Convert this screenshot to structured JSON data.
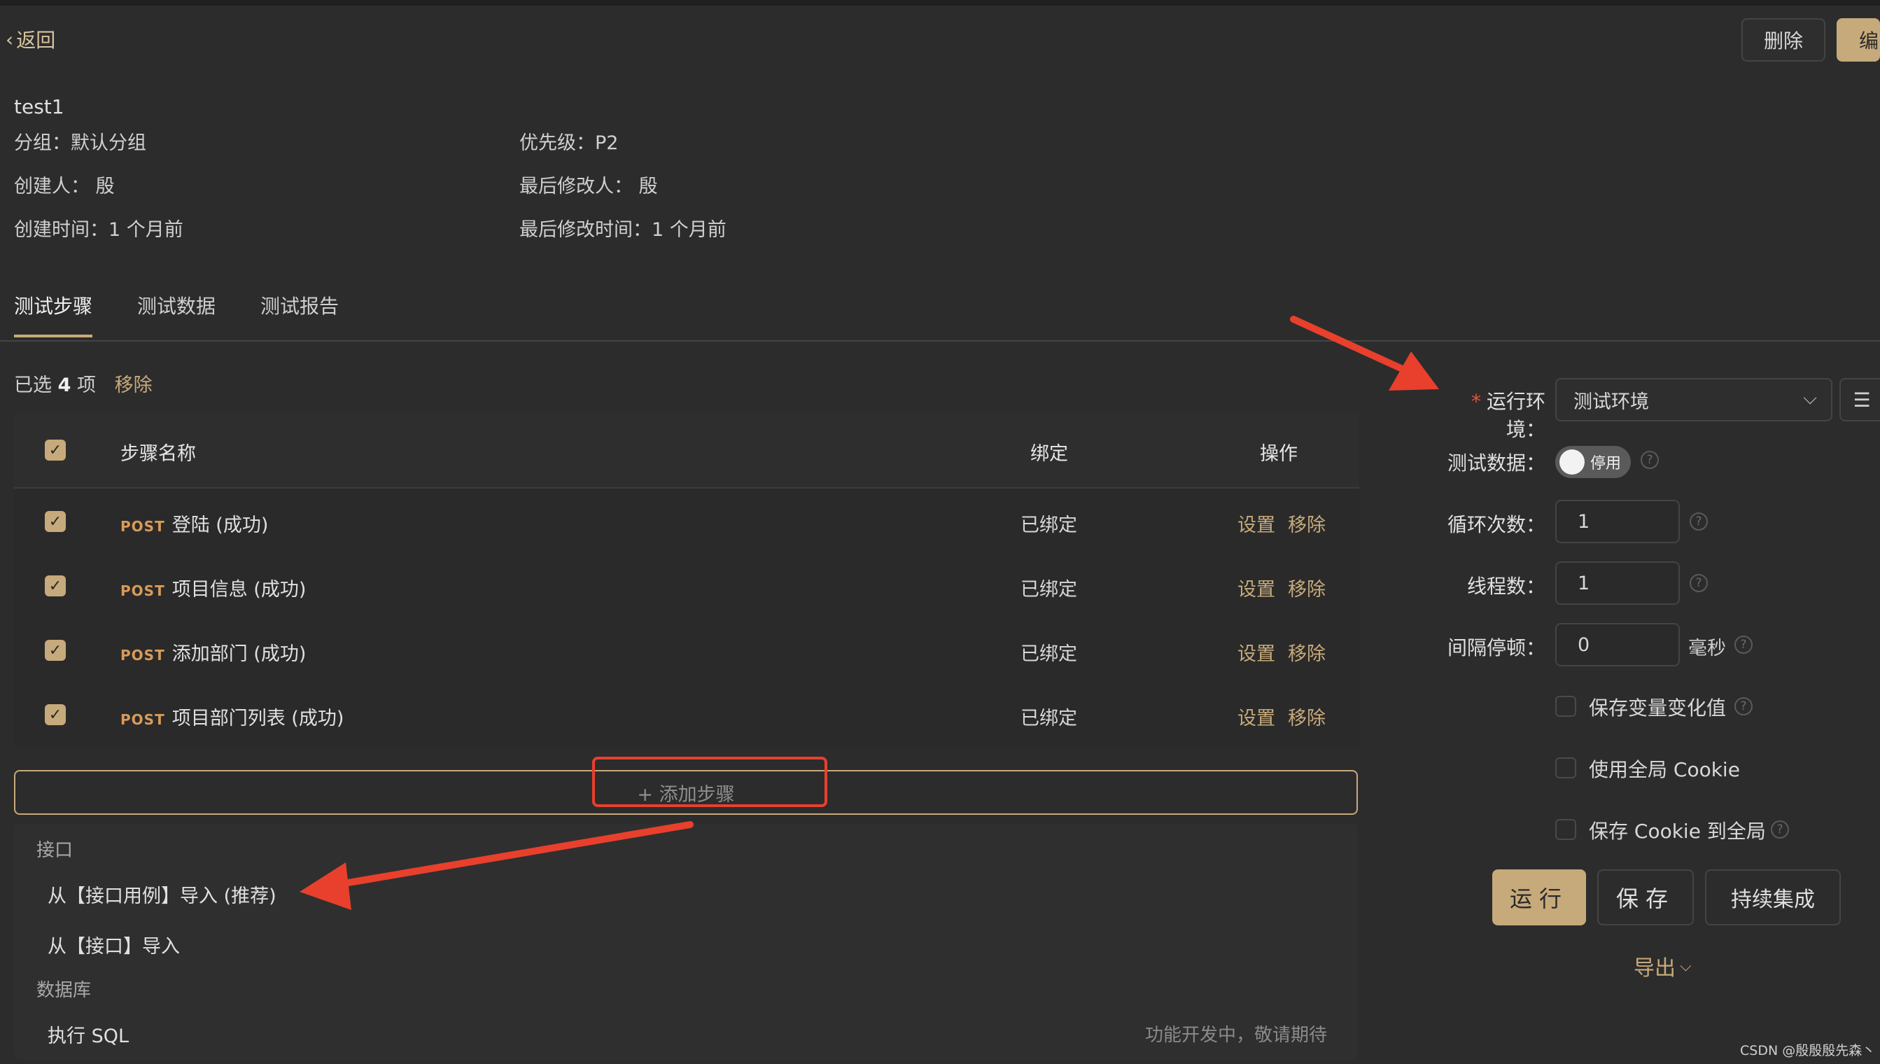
{
  "header": {
    "back_label": "返回",
    "delete_label": "删除",
    "edit_label": "编"
  },
  "meta": {
    "title": "test1",
    "group": "分组：默认分组",
    "priority": "优先级：P2",
    "creator": "创建人： 殷",
    "last_modifier": "最后修改人： 殷",
    "created_time": "创建时间：1 个月前",
    "modified_time": "最后修改时间：1 个月前"
  },
  "tabs": [
    {
      "label": "测试步骤",
      "active": true
    },
    {
      "label": "测试数据",
      "active": false
    },
    {
      "label": "测试报告",
      "active": false
    }
  ],
  "selection": {
    "prefix": "已选",
    "count": "4",
    "suffix": "项",
    "remove_label": "移除"
  },
  "table": {
    "columns": [
      "步骤名称",
      "绑定",
      "操作"
    ],
    "rows": [
      {
        "method": "POST",
        "name": "登陆 (成功)",
        "binding": "已绑定",
        "op_set": "设置",
        "op_remove": "移除",
        "checked": true
      },
      {
        "method": "POST",
        "name": "项目信息 (成功)",
        "binding": "已绑定",
        "op_set": "设置",
        "op_remove": "移除",
        "checked": true
      },
      {
        "method": "POST",
        "name": "添加部门 (成功)",
        "binding": "已绑定",
        "op_set": "设置",
        "op_remove": "移除",
        "checked": true
      },
      {
        "method": "POST",
        "name": "项目部门列表 (成功)",
        "binding": "已绑定",
        "op_set": "设置",
        "op_remove": "移除",
        "checked": true
      }
    ]
  },
  "add_step_label": "+ 添加步骤",
  "dropdown": {
    "group_api": "接口",
    "item_from_case": "从【接口用例】导入 (推荐)",
    "item_from_api": "从【接口】导入",
    "group_db": "数据库",
    "item_sql": "执行 SQL",
    "item_sql_note": "功能开发中，敬请期待"
  },
  "settings": {
    "env_label": "运行环境：",
    "env_required": "*",
    "env_value": "测试环境",
    "test_data_label": "测试数据：",
    "test_data_toggle": "停用",
    "loop_label": "循环次数：",
    "loop_value": "1",
    "threads_label": "线程数：",
    "threads_value": "1",
    "interval_label": "间隔停顿：",
    "interval_value": "0",
    "interval_unit": "毫秒",
    "save_var_label": "保存变量变化值",
    "use_global_cookie_label": "使用全局 Cookie",
    "save_cookie_global_label": "保存 Cookie 到全局"
  },
  "actions": {
    "run_label": "运行",
    "save_label": "保存",
    "ci_label": "持续集成",
    "export_label": "导出"
  },
  "watermark": "CSDN @殷殷殷先森丶",
  "colors": {
    "accent": "#c7aa7b",
    "background": "#2c2c2c",
    "method": "#d99a5a",
    "annotation_red": "#e8402c"
  }
}
